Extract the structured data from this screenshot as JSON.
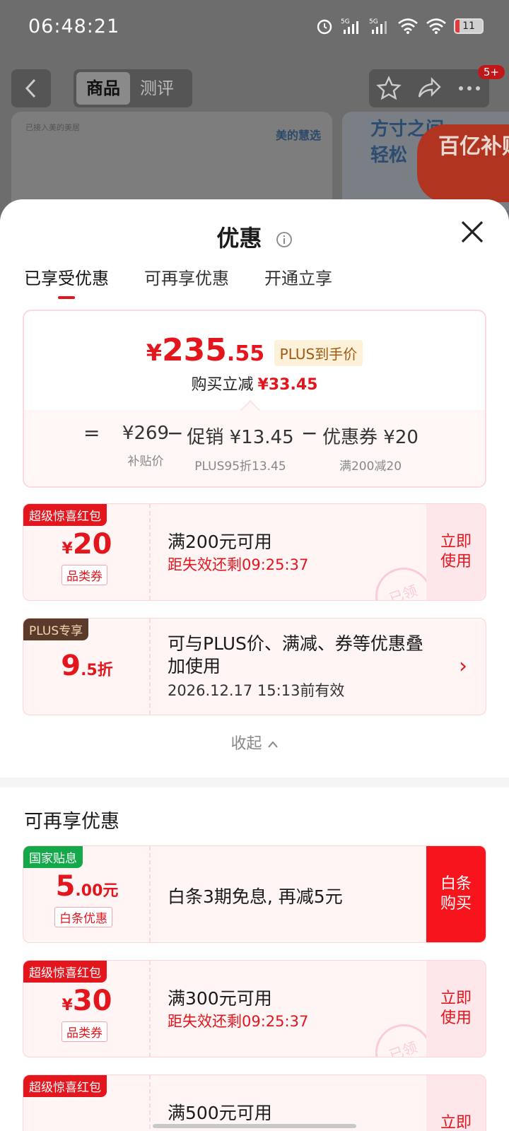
{
  "status": {
    "time": "06:48:21",
    "battery": "11"
  },
  "nav": {
    "tabs": [
      "商品",
      "测评"
    ],
    "badge": "5+"
  },
  "banner": {
    "left_tag": "已接入美的美居",
    "left_brand": "美的慧选",
    "right_promo": "方寸之间\n轻松",
    "subsidy": "百亿补贴"
  },
  "sheet": {
    "title": "优惠",
    "tabs": [
      "已享受优惠",
      "可再享优惠",
      "开通立享"
    ],
    "summary": {
      "currency": "¥",
      "price_int": "235",
      "price_dec": ".55",
      "plus_tag": "PLUS到手价",
      "reduce_label": "购买立减",
      "reduce_value": "¥33.45",
      "eq": "=",
      "minus": "−",
      "base_price": "¥269",
      "base_label": "补贴价",
      "promo": "促销 ¥13.45",
      "promo_label": "PLUS95折13.45",
      "coupon": "优惠券 ¥20",
      "coupon_label": "满200减20"
    },
    "coupons": [
      {
        "tag": "超级惊喜红包",
        "yen": "¥",
        "amount": "20",
        "suffix": "",
        "type": "品类券",
        "condition": "满200元可用",
        "expire": "距失效还剩09:25:37",
        "action": "立即\n使用",
        "stamp": "已领"
      },
      {
        "tag": "PLUS专享",
        "yen": "",
        "amount": "9",
        "suffix": ".5折",
        "type": "",
        "condition": "可与PLUS价、满减、券等优惠叠加使用",
        "expire": "2026.12.17 15:13前有效",
        "action": "›",
        "stamp": ""
      }
    ],
    "collapse_label": "收起",
    "section_title": "可再享优惠",
    "more_coupons": [
      {
        "tag": "国家贴息",
        "yen": "",
        "amount": "5",
        "suffix": ".00元",
        "type": "白条优惠",
        "condition": "白条3期免息, 再减5元",
        "expire": "",
        "action": "白条\n购买",
        "stamp": ""
      },
      {
        "tag": "超级惊喜红包",
        "yen": "¥",
        "amount": "30",
        "suffix": "",
        "type": "品类券",
        "condition": "满300元可用",
        "expire": "距失效还剩09:25:37",
        "action": "立即\n使用",
        "stamp": "已领"
      },
      {
        "tag": "超级惊喜红包",
        "yen": "",
        "amount": "",
        "suffix": "",
        "type": "",
        "condition": "满500元可用",
        "expire": "",
        "action": "立即",
        "stamp": ""
      }
    ]
  },
  "colors": {
    "accent": "#e3151d",
    "plus_bg": "#fdf1da",
    "coupon_bg": "#fff5f5"
  }
}
